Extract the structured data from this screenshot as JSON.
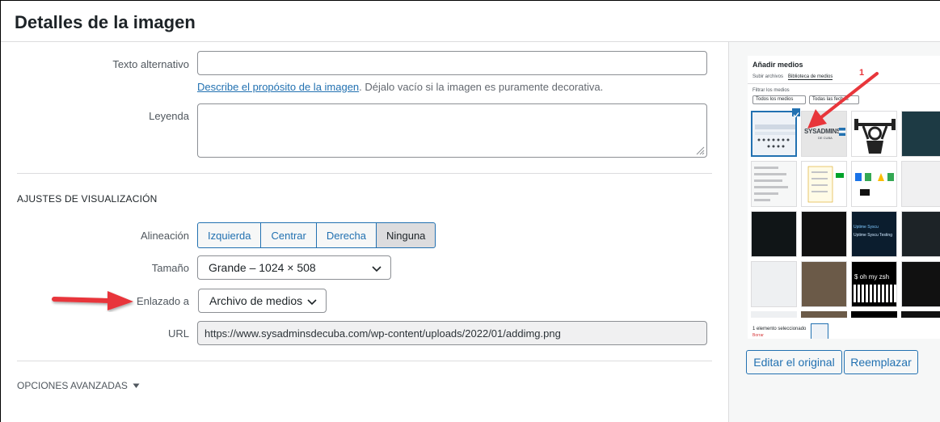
{
  "header": {
    "title": "Detalles de la imagen"
  },
  "fields": {
    "alt_text": {
      "label": "Texto alternativo",
      "value": "",
      "help_link": "Describe el propósito de la imagen",
      "help_rest": ". Déjalo vacío si la imagen es puramente decorativa."
    },
    "caption": {
      "label": "Leyenda",
      "value": ""
    }
  },
  "display": {
    "title": "Ajustes de visualización",
    "alignment": {
      "label": "Alineación",
      "options": [
        "Izquierda",
        "Centrar",
        "Derecha",
        "Ninguna"
      ],
      "selected": "Ninguna"
    },
    "size": {
      "label": "Tamaño",
      "value": "Grande – 1024 × 508"
    },
    "link_to": {
      "label": "Enlazado a",
      "value": "Archivo de medios"
    },
    "url": {
      "label": "URL",
      "value": "https://www.sysadminsdecuba.com/wp-content/uploads/2022/01/addimg.png"
    }
  },
  "advanced": {
    "label": "Opciones avanzadas"
  },
  "sidebar": {
    "preview": {
      "title": "Añadir medios",
      "tabs": [
        "Subir archivos",
        "Biblioteca de medios"
      ],
      "filter_label": "Filtrar los medios",
      "filter_type": "Todos los medios",
      "filter_date": "Todas las fechas",
      "tile_sysadmins": "SYSADMINS",
      "tile_sysadmins_sub": "DE CUBA",
      "tile_uptime_1": "Uptime Syscu",
      "tile_uptime_2": "Uptime Syscu Testing",
      "tile_zsh": "$ oh my zsh",
      "annotation_number": "1",
      "footer": "1 elemento seleccionado",
      "footer_clear": "Borrar"
    },
    "edit_original": "Editar el original",
    "replace": "Reemplazar"
  },
  "colors": {
    "accent": "#2271b1",
    "arrow": "#e8363b"
  }
}
